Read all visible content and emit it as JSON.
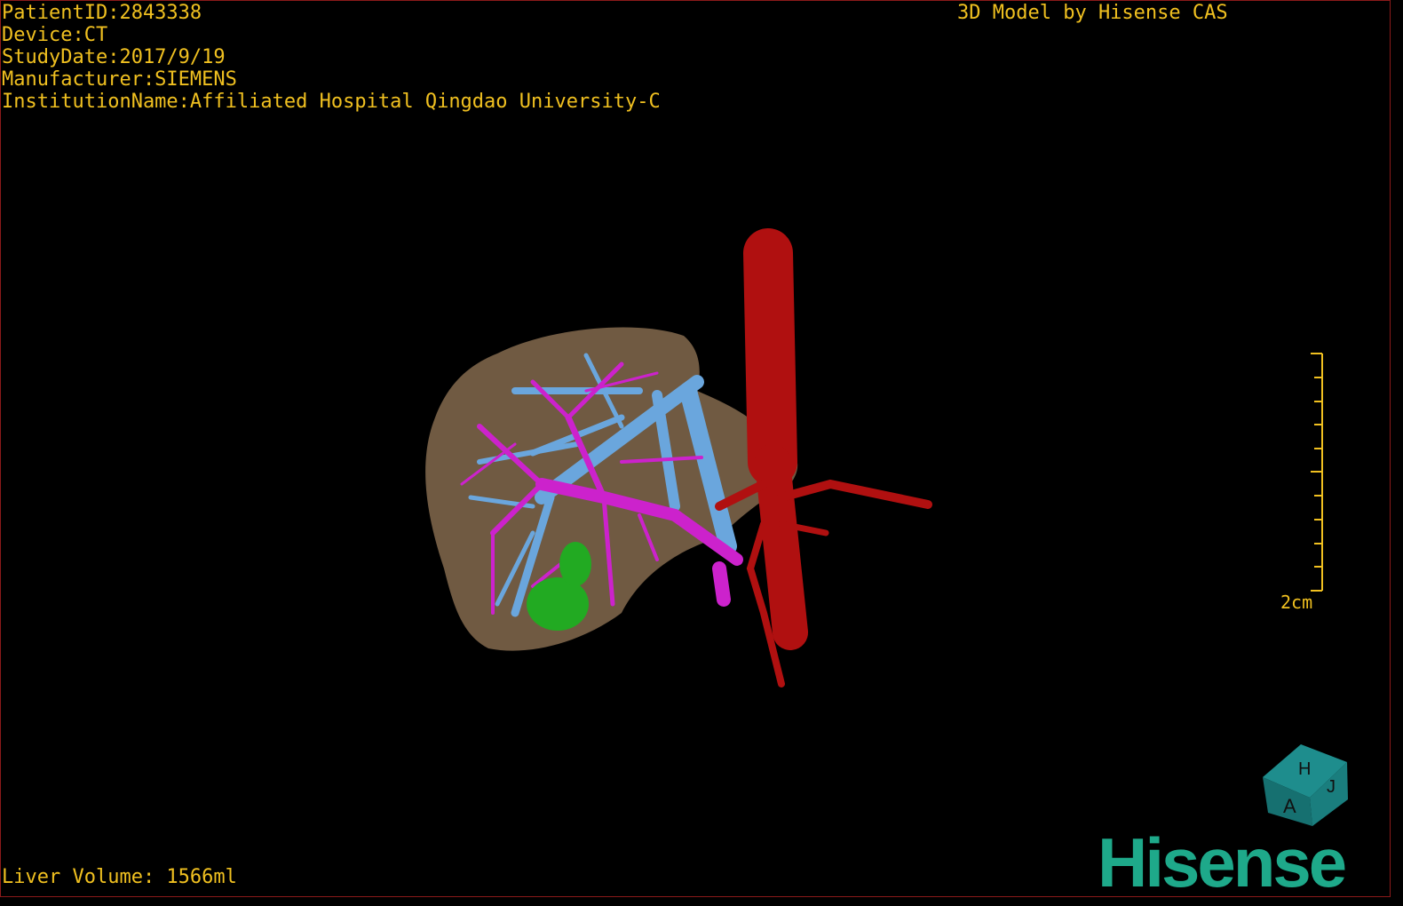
{
  "overlay": {
    "patient_id": "PatientID:2843338",
    "device": "Device:CT",
    "study_date": "StudyDate:2017/9/19",
    "manufacturer": "Manufacturer:SIEMENS",
    "institution": "InstitutionName:Affiliated Hospital Qingdao University-C",
    "credit": "3D Model by Hisense CAS",
    "liver_volume": "Liver Volume: 1566ml"
  },
  "scale_bar": {
    "label": "2cm"
  },
  "orientation_cube": {
    "face_top": "H",
    "face_front": "A",
    "face_side": "J"
  },
  "logo": {
    "text": "Hisense"
  },
  "colors": {
    "text": "#f0c020",
    "liver": "#7a6248",
    "portal_vein": "#cc22cc",
    "hepatic_vein": "#6aa6dd",
    "artery": "#b01010",
    "gallbladder": "#22aa22",
    "logo": "#1ea98a",
    "cube": "#1e8d8d"
  }
}
